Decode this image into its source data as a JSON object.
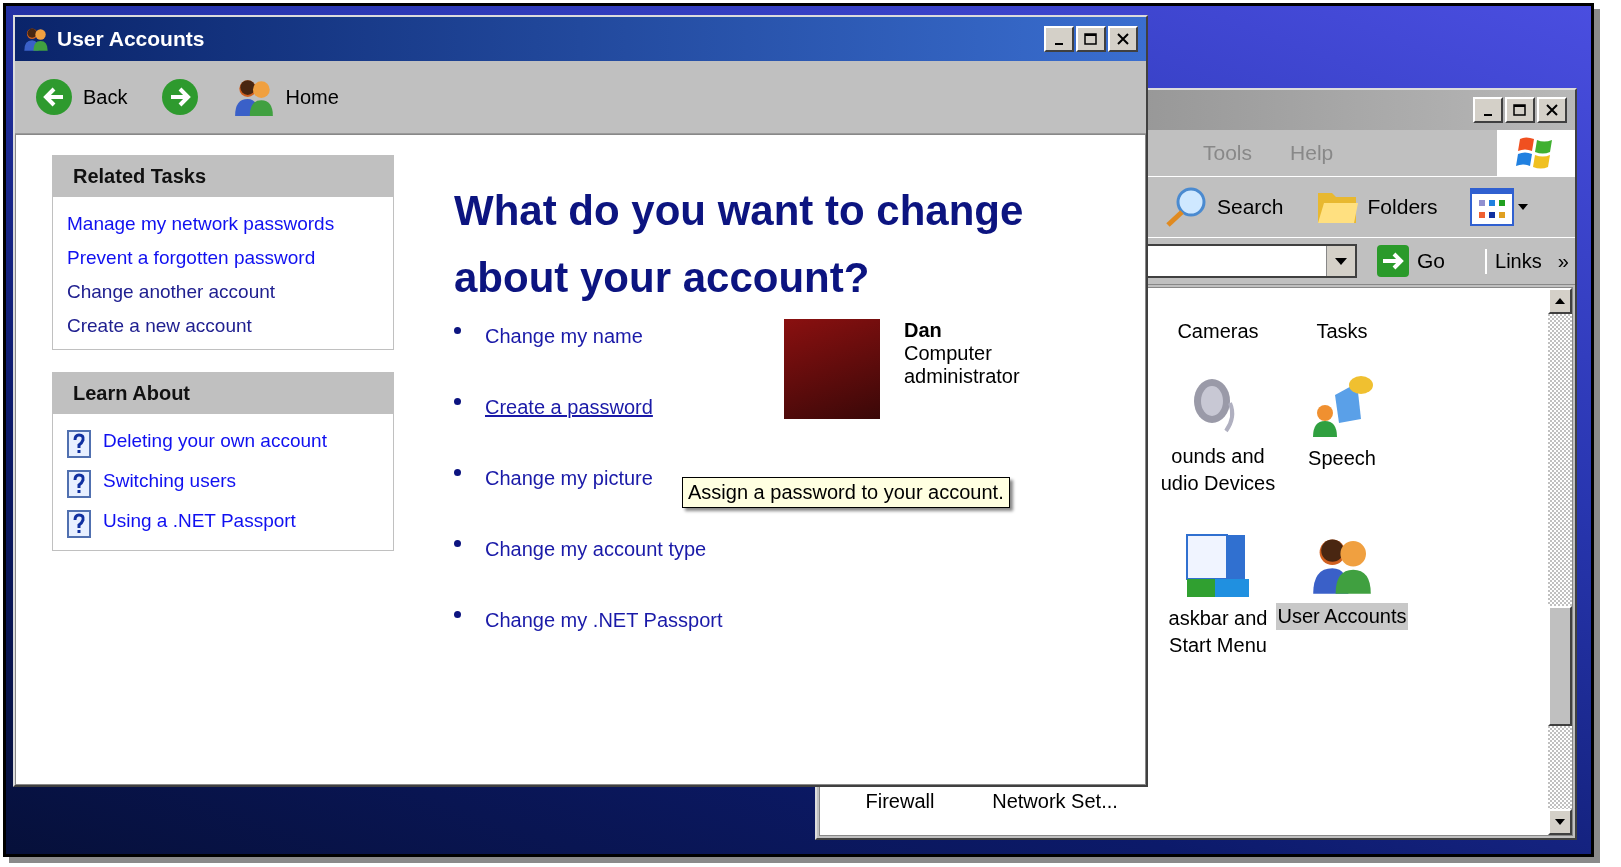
{
  "user_accounts_window": {
    "title": "User Accounts",
    "toolbar": [
      {
        "kind": "back",
        "label": "Back"
      },
      {
        "kind": "forward"
      },
      {
        "kind": "home",
        "label": "Home"
      }
    ],
    "related_tasks": {
      "title": "Related Tasks",
      "links": [
        {
          "label": "Manage my network passwords",
          "visited": false
        },
        {
          "label": "Prevent a forgotten password",
          "visited": false
        },
        {
          "label": "Change another account",
          "visited": true
        },
        {
          "label": "Create a new account",
          "visited": true
        }
      ]
    },
    "learn_about": {
      "title": "Learn About",
      "links": [
        {
          "label": "Deleting your own account"
        },
        {
          "label": "Switching users"
        },
        {
          "label": "Using a .NET Passport"
        }
      ]
    },
    "heading": "What do you want to change about your account?",
    "tasks": [
      {
        "label": "Change my name",
        "hovered": false
      },
      {
        "label": "Create a password",
        "hovered": true
      },
      {
        "label": "Change my picture",
        "hovered": false
      },
      {
        "label": "Change my account type",
        "hovered": false
      },
      {
        "label": "Change my .NET Passport",
        "hovered": false
      }
    ],
    "account": {
      "name": "Dan",
      "type": "Computer administrator"
    },
    "tooltip": "Assign a password to your account."
  },
  "control_panel_window": {
    "menu": [
      "Tools",
      "Help"
    ],
    "toolbar": [
      {
        "kind": "search",
        "label": "Search"
      },
      {
        "kind": "folders",
        "label": "Folders"
      },
      {
        "kind": "views"
      }
    ],
    "address": {
      "go": "Go",
      "links": "Links",
      "chevron": "»"
    },
    "icons": [
      {
        "kind": "none",
        "lines": [
          "Cameras"
        ],
        "selected": false
      },
      {
        "kind": "none",
        "lines": [
          "Tasks"
        ],
        "selected": false
      },
      {
        "kind": "speaker",
        "lines": [
          "ounds and",
          "udio Devices"
        ],
        "selected": false
      },
      {
        "kind": "speech",
        "lines": [
          "Speech"
        ],
        "selected": false
      },
      {
        "kind": "taskbar",
        "lines": [
          "askbar and",
          "Start Menu"
        ],
        "selected": false
      },
      {
        "kind": "users",
        "lines": [
          "User Accounts"
        ],
        "selected": true
      }
    ],
    "bottom_row": [
      {
        "lines": [
          "Firewall"
        ]
      },
      {
        "lines": [
          "Network Set..."
        ]
      }
    ]
  }
}
